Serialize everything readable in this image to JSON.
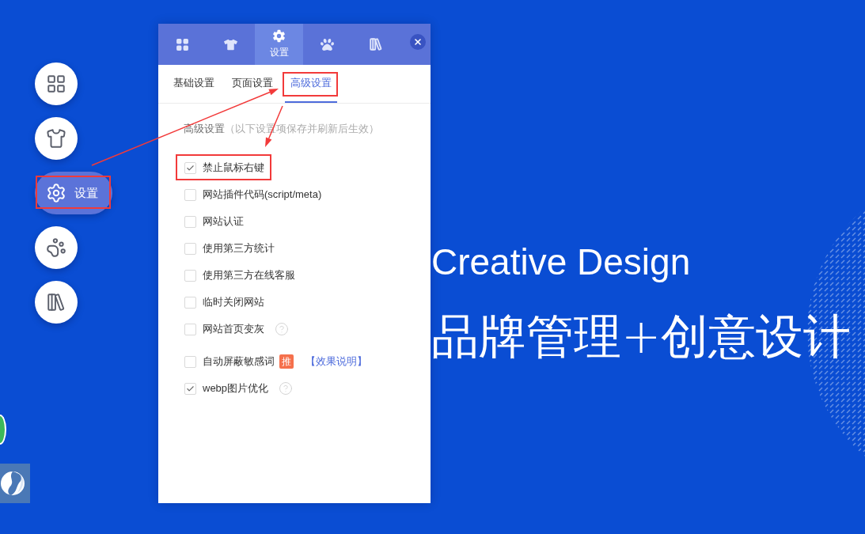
{
  "sidebar": {
    "items": [
      {
        "selected": false,
        "highlighted": false
      },
      {
        "selected": false,
        "highlighted": false
      },
      {
        "label": "设置",
        "selected": true,
        "highlighted": true
      },
      {
        "selected": false,
        "highlighted": false
      },
      {
        "selected": false,
        "highlighted": false
      }
    ]
  },
  "panel": {
    "tabs": [
      {
        "selected": false
      },
      {
        "selected": false
      },
      {
        "label": "设置",
        "selected": true
      },
      {
        "selected": false
      },
      {
        "selected": false
      }
    ],
    "subtabs": [
      {
        "label": "基础设置",
        "selected": false,
        "highlighted": false
      },
      {
        "label": "页面设置",
        "selected": false,
        "highlighted": false
      },
      {
        "label": "高级设置",
        "selected": true,
        "highlighted": true
      }
    ],
    "section": {
      "title": "高级设置",
      "note": "（以下设置项保存并刷新后生效）"
    },
    "options": [
      {
        "label": "禁止鼠标右键",
        "checked": true,
        "help": false,
        "highlighted": true
      },
      {
        "label": "网站插件代码(script/meta)",
        "checked": false,
        "help": false,
        "highlighted": false
      },
      {
        "label": "网站认证",
        "checked": false,
        "help": false,
        "highlighted": false
      },
      {
        "label": "使用第三方统计",
        "checked": false,
        "help": false,
        "highlighted": false
      },
      {
        "label": "使用第三方在线客服",
        "checked": false,
        "help": false,
        "highlighted": false
      },
      {
        "label": "临时关闭网站",
        "checked": false,
        "help": false,
        "highlighted": false
      },
      {
        "label": "网站首页变灰",
        "checked": false,
        "help": true,
        "highlighted": false
      },
      {
        "label": "自动屏蔽敏感词",
        "checked": false,
        "help": false,
        "highlighted": false,
        "badge": "推",
        "link": "【效果说明】"
      },
      {
        "label": "webp图片优化",
        "checked": true,
        "help": true,
        "highlighted": false
      }
    ]
  },
  "hero": {
    "title": "Creative Design",
    "subtitle": "品牌管理+创意设计"
  }
}
